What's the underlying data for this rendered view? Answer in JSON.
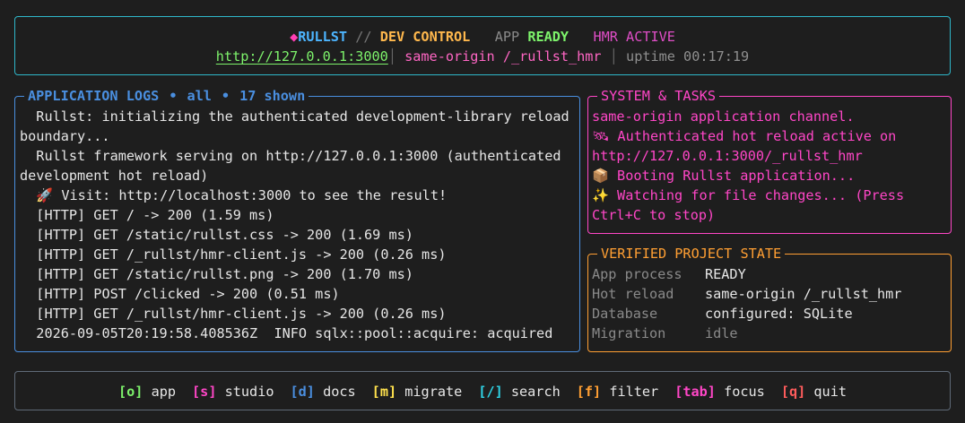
{
  "header": {
    "diamond": "◆",
    "brand": "RULLST",
    "separator": "//",
    "mode": "DEV CONTROL",
    "app_label": "APP",
    "app_status": "READY",
    "hmr_status": "HMR ACTIVE",
    "url": "http://127.0.0.1:3000",
    "divider": "│",
    "origin": "same-origin /_rullst_hmr",
    "uptime": "uptime 00:17:19"
  },
  "logs": {
    "title": "APPLICATION LOGS",
    "dot": "•",
    "filter": "all",
    "count": "17 shown",
    "lines": [
      "  Rullst: initializing the authenticated development-library reload boundary...",
      "  Rullst framework serving on http://127.0.0.1:3000 (authenticated development hot reload)",
      "  🚀 Visit: http://localhost:3000 to see the result!",
      "  [HTTP] GET / -> 200 (1.59 ms)",
      "  [HTTP] GET /static/rullst.css -> 200 (1.69 ms)",
      "  [HTTP] GET /_rullst/hmr-client.js -> 200 (0.26 ms)",
      "  [HTTP] GET /static/rullst.png -> 200 (1.70 ms)",
      "  [HTTP] POST /clicked -> 200 (0.51 ms)",
      "  [HTTP] GET /_rullst/hmr-client.js -> 200 (0.26 ms)",
      "  2026-09-05T20:19:58.408536Z  INFO sqlx::pool::acquire: acquired"
    ]
  },
  "system": {
    "title": "SYSTEM & TASKS",
    "lines": [
      "same-origin application channel.",
      "🛰 Authenticated hot reload active on http://127.0.0.1:3000/_rullst_hmr",
      "📦 Booting Rullst application...",
      "✨ Watching for file changes... (Press Ctrl+C to stop)"
    ]
  },
  "verified": {
    "title": "VERIFIED PROJECT STATE",
    "rows": [
      {
        "key": "App process",
        "value": "READY"
      },
      {
        "key": "Hot reload",
        "value": "same-origin /_rullst_hmr"
      },
      {
        "key": "Database",
        "value": "configured: SQLite"
      },
      {
        "key": "Migration",
        "value": "idle"
      }
    ]
  },
  "footer": {
    "keys": [
      {
        "key": "[o]",
        "label": "app",
        "color": "#7df26b"
      },
      {
        "key": "[s]",
        "label": "studio",
        "color": "#ff46c7"
      },
      {
        "key": "[d]",
        "label": "docs",
        "color": "#4a8fe0"
      },
      {
        "key": "[m]",
        "label": "migrate",
        "color": "#ffe14d"
      },
      {
        "key": "[/]",
        "label": "search",
        "color": "#2fd3e6"
      },
      {
        "key": "[f]",
        "label": "filter",
        "color": "#ff9f33"
      },
      {
        "key": "[tab]",
        "label": "focus",
        "color": "#ff46c7"
      },
      {
        "key": "[q]",
        "label": "quit",
        "color": "#ff5c5c"
      }
    ]
  }
}
